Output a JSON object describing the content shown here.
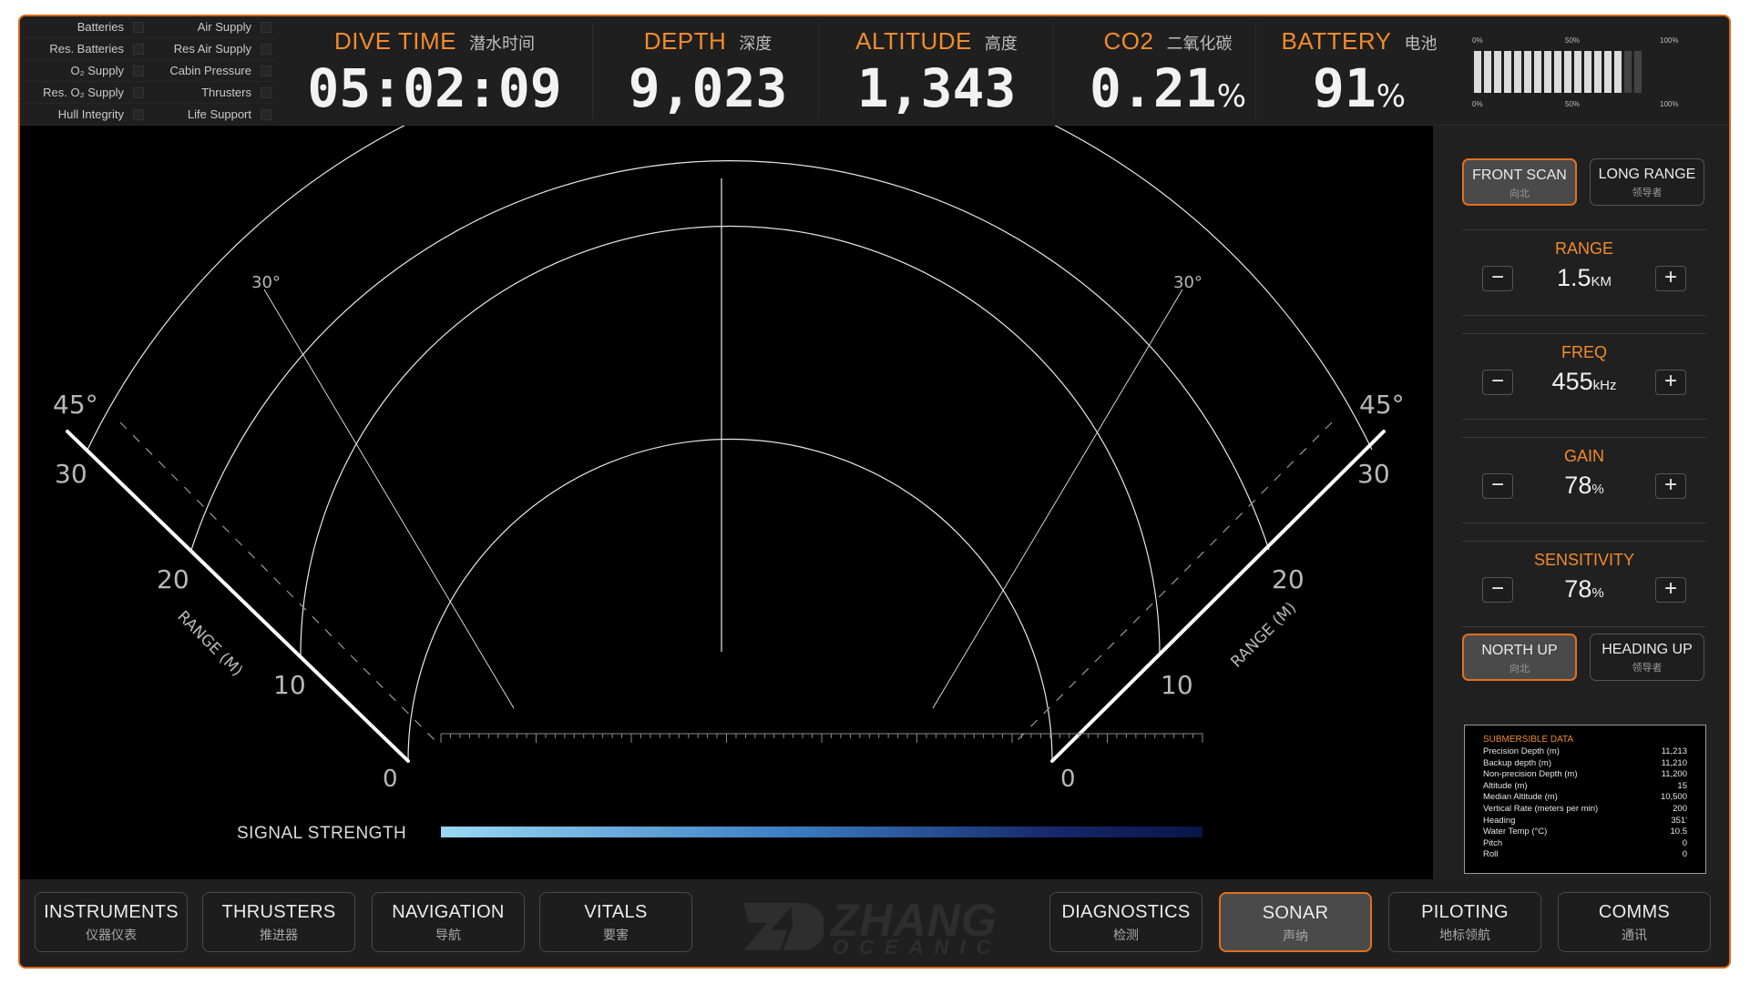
{
  "status_lights": {
    "left": [
      "Batteries",
      "Res. Batteries",
      "O₂ Supply",
      "Res. O₂ Supply",
      "Hull Integrity"
    ],
    "right": [
      "Air Supply",
      "Res Air Supply",
      "Cabin Pressure",
      "Thrusters",
      "Life Support"
    ]
  },
  "metrics": {
    "dive_time": {
      "label": "DIVE TIME",
      "label_zh": "潜水时间",
      "value": "05:02:09",
      "unit": ""
    },
    "depth": {
      "label": "DEPTH",
      "label_zh": "深度",
      "value": "9,023",
      "unit": ""
    },
    "altitude": {
      "label": "ALTITUDE",
      "label_zh": "高度",
      "value": "1,343",
      "unit": ""
    },
    "co2": {
      "label": "CO2",
      "label_zh": "二氧化碳",
      "value": "0.21",
      "unit": "%"
    },
    "battery": {
      "label": "BATTERY",
      "label_zh": "电池",
      "value": "91",
      "unit": "%"
    }
  },
  "battery_gauge": {
    "level": 0.91,
    "ticks": [
      "0%",
      "50%",
      "100%"
    ]
  },
  "sonar": {
    "angle_labels": {
      "left_outer": "45°",
      "right_outer": "45°",
      "left_inner": "30°",
      "right_inner": "30°"
    },
    "range_ticks": [
      "30",
      "20",
      "10",
      "0"
    ],
    "range_axis_label": "RANGE (M)",
    "signal_label": "SIGNAL STRENGTH"
  },
  "controls": {
    "scan_modes": [
      {
        "label": "FRONT SCAN",
        "label_zh": "向北",
        "active": true
      },
      {
        "label": "LONG RANGE",
        "label_zh": "领导者",
        "active": false
      }
    ],
    "range": {
      "title": "RANGE",
      "value": "1.5",
      "unit": "KM"
    },
    "freq": {
      "title": "FREQ",
      "value": "455",
      "unit": "kHz"
    },
    "gain": {
      "title": "GAIN",
      "value": "78",
      "unit": "%"
    },
    "sensitivity": {
      "title": "SENSITIVITY",
      "value": "78",
      "unit": "%"
    },
    "orient_modes": [
      {
        "label": "NORTH UP",
        "label_zh": "向北",
        "active": true
      },
      {
        "label": "HEADING UP",
        "label_zh": "领导者",
        "active": false
      }
    ],
    "minus_symbol": "−",
    "plus_symbol": "+"
  },
  "submersible_data": {
    "title": "SUBMERSIBLE DATA",
    "rows": [
      {
        "k": "Precision Depth (m)",
        "v": "11,213"
      },
      {
        "k": "Backup depth (m)",
        "v": "11,210"
      },
      {
        "k": "Non-precision Depth (m)",
        "v": "11,200"
      },
      {
        "k": "Altitude (m)",
        "v": "15"
      },
      {
        "k": "Median Altitude (m)",
        "v": "10,500"
      },
      {
        "k": "Vertical Rate (meters per min)",
        "v": "200"
      },
      {
        "k": "Heading",
        "v": "351'"
      },
      {
        "k": "Water Temp (°C)",
        "v": "10.5"
      },
      {
        "k": "Pitch",
        "v": "0"
      },
      {
        "k": "Roll",
        "v": "0"
      }
    ]
  },
  "nav": [
    {
      "label": "INSTRUMENTS",
      "label_zh": "仪器仪表",
      "active": false
    },
    {
      "label": "THRUSTERS",
      "label_zh": "推进器",
      "active": false
    },
    {
      "label": "NAVIGATION",
      "label_zh": "导航",
      "active": false
    },
    {
      "label": "VITALS",
      "label_zh": "要害",
      "active": false
    },
    {
      "label": "DIAGNOSTICS",
      "label_zh": "检测",
      "active": false
    },
    {
      "label": "SONAR",
      "label_zh": "声纳",
      "active": true
    },
    {
      "label": "PILOTING",
      "label_zh": "地标领航",
      "active": false
    },
    {
      "label": "COMMS",
      "label_zh": "通讯",
      "active": false
    }
  ],
  "logo": {
    "word1": "ZHANG",
    "word2": "OCEANIC"
  },
  "colors": {
    "accent": "#f28b2c",
    "frame": "#d4691c",
    "signal_start": "#9ad8f5",
    "signal_end": "#0a1448"
  }
}
